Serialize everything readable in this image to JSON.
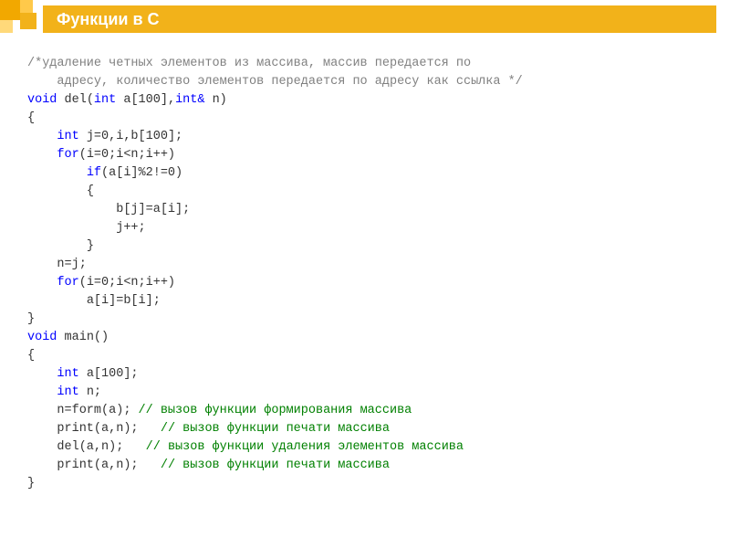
{
  "title": "Функции в С",
  "code": {
    "line1": "/*удаление четных элементов из массива, массив передается по",
    "line2": "    адресу, количество элементов передается по адресу как ссылка */",
    "void": "void",
    "int": "int",
    "intAmp": "int&",
    "for": "for",
    "if": "if",
    "delSig": "del(",
    "aParam": "a[100],",
    "nParam": "n)",
    "lbrace": "{",
    "rbrace": "}",
    "decl1": "j=0,i,b[100];",
    "for1": "(i=0;i<n;i++)",
    "if1": "(a[i]%2!=0)",
    "assign1": "b[j]=a[i];",
    "jpp": "j++;",
    "nj": "n=j;",
    "assign2": "a[i]=b[i];",
    "mainSig": "main()",
    "decl2": "a[100];",
    "decl3": "n;",
    "callForm": "n=form(a);",
    "callPrint": "print(a,n);",
    "callDel": "del(a,n);",
    "cForm": "// вызов функции формирования массива",
    "cPrint": "// вызов функции печати массива",
    "cDel": "// вызов функции удаления элементов массива"
  }
}
